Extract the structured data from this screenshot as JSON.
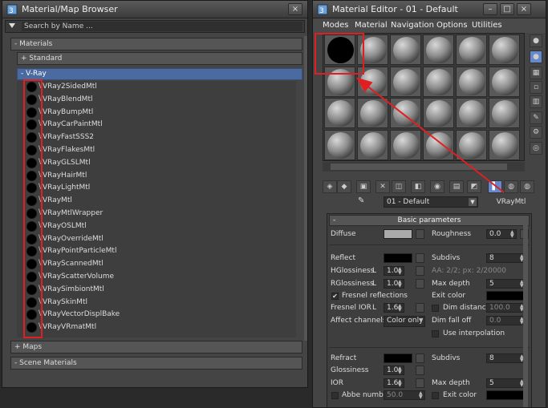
{
  "browser": {
    "title": "Material/Map Browser",
    "search_placeholder": "Search by Name ...",
    "section_materials": "- Materials",
    "group_standard": "+ Standard",
    "group_vray": "- V-Ray",
    "materials": [
      "VRay2SidedMtl",
      "VRayBlendMtl",
      "VRayBumpMtl",
      "VRayCarPaintMtl",
      "VRayFastSSS2",
      "VRayFlakesMtl",
      "VRayGLSLMtl",
      "VRayHairMtl",
      "VRayLightMtl",
      "VRayMtl",
      "VRayMtlWrapper",
      "VRayOSLMtl",
      "VRayOverrideMtl",
      "VRayPointParticleMtl",
      "VRayScannedMtl",
      "VRayScatterVolume",
      "VRaySimbiontMtl",
      "VRaySkinMtl",
      "VRayVectorDisplBake",
      "VRayVRmatMtl"
    ],
    "section_maps": "+ Maps",
    "section_scene": "- Scene Materials",
    "close_glyph": "×"
  },
  "editor": {
    "title": "Material Editor - 01 - Default",
    "menu": [
      "Modes",
      "Material",
      "Navigation",
      "Options",
      "Utilities"
    ],
    "material_name": "01 - Default",
    "material_type": "VRayMtl",
    "params_header": "Basic parameters",
    "diffuse_label": "Diffuse",
    "roughness_label": "Roughness",
    "roughness_value": "0.0",
    "reflect_label": "Reflect",
    "subdivs_label": "Subdivs",
    "subdivs_value": "8",
    "aa_text": "AA: 2/2; px: 2/20000",
    "hgloss_label": "HGlossiness",
    "hgloss_value": "1.0",
    "rgloss_label": "RGlossiness",
    "rgloss_value": "1.0",
    "maxdepth_label": "Max depth",
    "maxdepth_value": "5",
    "fresnel_label": "Fresnel reflections",
    "exitcolor_label": "Exit color",
    "fresnelior_label": "Fresnel IOR",
    "fresnelior_value": "1.6",
    "dimdist_label": "Dim distance",
    "dimdist_value": "100.0",
    "affect_label": "Affect channels",
    "affect_value": "Color only",
    "dimfalloff_label": "Dim fall off",
    "dimfalloff_value": "0.0",
    "useinterp_label": "Use interpolation",
    "refract_label": "Refract",
    "refract_subdivs_value": "8",
    "glossiness_label": "Glossiness",
    "glossiness_value": "1.0",
    "ior_label": "IOR",
    "ior_value": "1.6",
    "refract_maxdepth_value": "5",
    "abbe_label": "Abbe number",
    "abbe_value": "50.0",
    "lock_glyph": "L",
    "picker_glyph": "✎",
    "dropdown_glyph": "▼",
    "check_glyph": "✔"
  },
  "colors": {
    "highlight": "#e02020",
    "selection": "#4a6aa0"
  }
}
